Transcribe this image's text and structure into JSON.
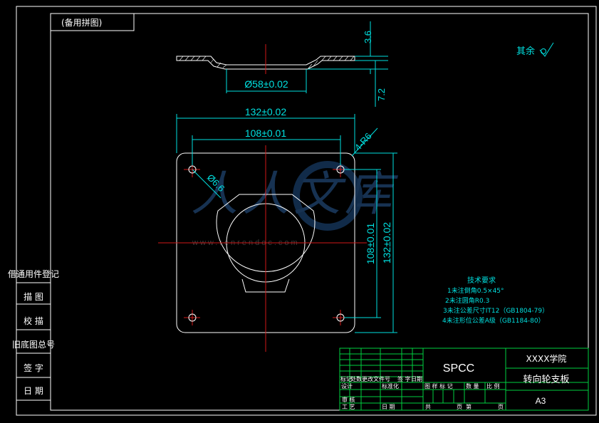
{
  "drawing": {
    "code_box": "(备用拼图)",
    "roughness_note": "其余",
    "material": "SPCC",
    "school": "XXXX学院",
    "part_name": "转向轮支板",
    "sheet_size": "A3"
  },
  "dimensions": {
    "height_top": "3.6",
    "height_total": "7.2",
    "boss_diameter": "Ø58±0.02",
    "width_outer": "132±0.02",
    "width_holes": "108±0.01",
    "corner_radius": "4-R6",
    "hole_diameter": "Ø6.6",
    "height_holes": "108±0.01",
    "height_outer": "132±0.02"
  },
  "tech_requirements": {
    "title": "技术要求",
    "items": [
      "1未注倒角0.5×45°",
      "2未注圆角R0.3",
      "3未注公差尺寸IT12（GB1804-79）",
      "4未注形位公差A级（GB1184-80）"
    ]
  },
  "left_strip": {
    "items": [
      "借通用件登记",
      "描 图",
      "校 描",
      "旧底图总号",
      "签 字",
      "日 期"
    ]
  },
  "title_block": {
    "rev_row": [
      "标记",
      "处数",
      "更改文件号",
      "签 字",
      "日期"
    ],
    "design": "设计",
    "standard": "标准化",
    "check": "审 核",
    "process": "工 艺",
    "date": "日 期",
    "stage_headers": [
      "图 样 标 记",
      "数 量",
      "比 例"
    ],
    "total": "共",
    "sheet_unit": "页",
    "page": "第",
    "page_unit": "页"
  },
  "watermark": {
    "text": "人人文库",
    "url": "www.renrendoc.com"
  }
}
